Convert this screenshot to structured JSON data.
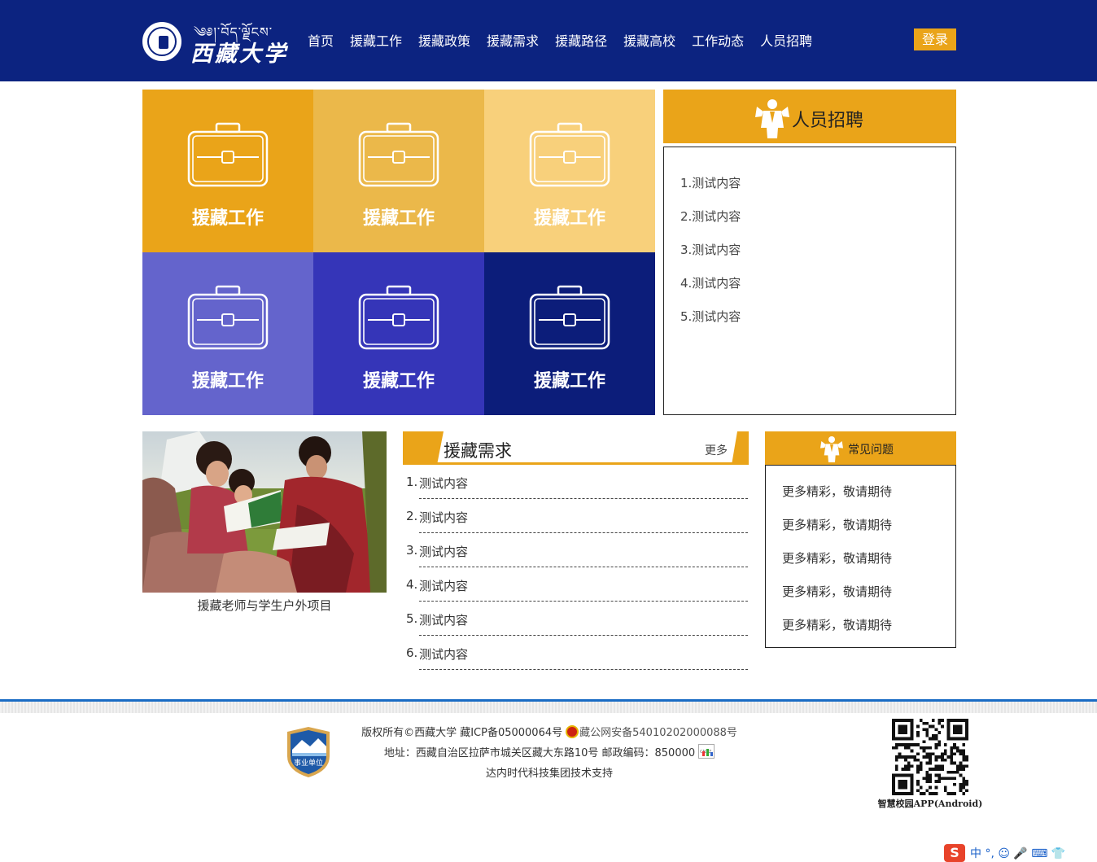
{
  "header": {
    "logo_tibetan": "༄༅།་བོད་ལྗོངས་",
    "logo_chinese": "西藏大学",
    "nav": [
      "首页",
      "援藏工作",
      "援藏政策",
      "援藏需求",
      "援藏路径",
      "援藏高校",
      "工作动态",
      "人员招聘"
    ],
    "login_label": "登录",
    "bg_color": "#0c2380",
    "accent_color": "#eaa419"
  },
  "tiles": [
    {
      "label": "援藏工作",
      "color": "#eaa419",
      "icon": "briefcase-icon"
    },
    {
      "label": "援藏工作",
      "color": "#ebb84a",
      "icon": "briefcase-icon"
    },
    {
      "label": "援藏工作",
      "color": "#f8d07b",
      "icon": "briefcase-icon"
    },
    {
      "label": "援藏工作",
      "color": "#6464cc",
      "icon": "briefcase-icon"
    },
    {
      "label": "援藏工作",
      "color": "#3535b8",
      "icon": "briefcase-icon"
    },
    {
      "label": "援藏工作",
      "color": "#0c1d7a",
      "icon": "briefcase-icon"
    }
  ],
  "recruit": {
    "title": "人员招聘",
    "icon": "person-icon",
    "items": [
      "1.测试内容",
      "2.测试内容",
      "3.测试内容",
      "4.测试内容",
      "5.测试内容"
    ]
  },
  "photo": {
    "caption": "援藏老师与学生户外项目"
  },
  "demand": {
    "title": "援藏需求",
    "more_label": "更多",
    "items": [
      {
        "num": "1.",
        "text": "测试内容"
      },
      {
        "num": "2.",
        "text": "测试内容"
      },
      {
        "num": "3.",
        "text": "测试内容"
      },
      {
        "num": "4.",
        "text": "测试内容"
      },
      {
        "num": "5.",
        "text": "测试内容"
      },
      {
        "num": "6.",
        "text": "测试内容"
      }
    ]
  },
  "faq": {
    "title": "常见问题",
    "items": [
      "更多精彩，敬请期待",
      "更多精彩，敬请期待",
      "更多精彩，敬请期待",
      "更多精彩，敬请期待",
      "更多精彩，敬请期待"
    ]
  },
  "footer": {
    "badge_label": "事业单位",
    "copyright": "版权所有©西藏大学 藏ICP备05000064号",
    "police_record": "藏公网安备54010202000088号",
    "address": "地址：西藏自治区拉萨市城关区藏大东路10号 邮政编码：850000",
    "cnzz_label": "CNZZ",
    "support": "达内时代科技集团技术支持",
    "qr_caption": "智慧校园APP(Android)",
    "rule_color": "#1a6cc4"
  },
  "ime": {
    "brand": "S",
    "status": "中 °, ☺ 🎤 ⌨ 👕"
  }
}
